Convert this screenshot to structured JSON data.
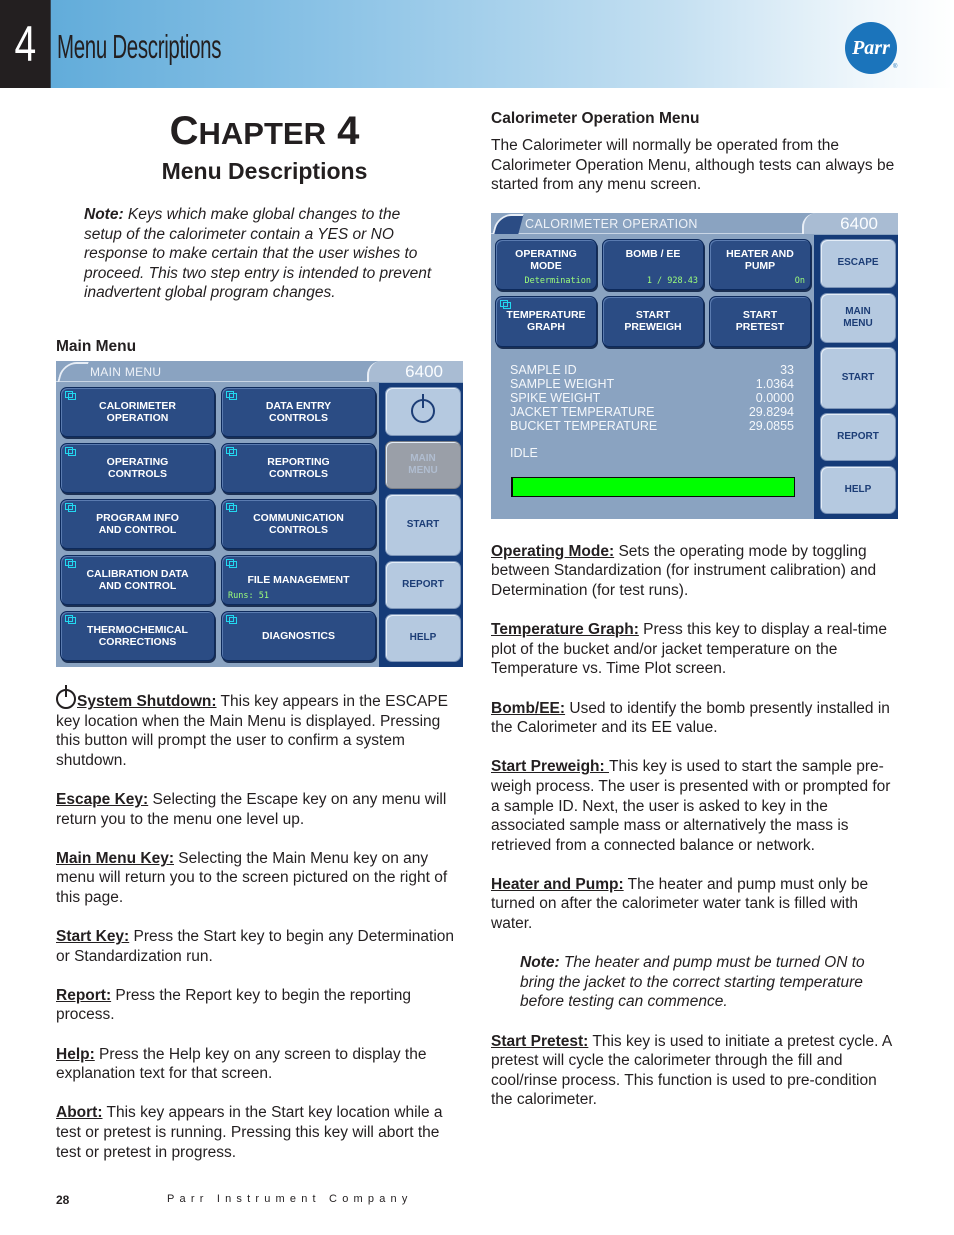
{
  "header": {
    "chapter_number": "4",
    "title": "Menu Descriptions",
    "logo_text": "Parr",
    "logo_reg": "®"
  },
  "left": {
    "chapter_word_first": "C",
    "chapter_word_rest": "HAPTER",
    "chapter_number": "4",
    "subtitle": "Menu Descriptions",
    "note_label": "Note:",
    "note_text": " Keys which make global changes to the setup of the calorimeter contain a YES or NO response to make certain that the user wishes to proceed.  This two step entry is intended to prevent inadvertent global program changes.",
    "main_menu_heading": "Main Menu",
    "main_menu_screen": {
      "title": "MAIN MENU",
      "model": "6400",
      "buttons": [
        {
          "label1": "CALORIMETER",
          "label2": "OPERATION"
        },
        {
          "label1": "DATA ENTRY",
          "label2": "CONTROLS"
        },
        {
          "label1": "OPERATING",
          "label2": "CONTROLS"
        },
        {
          "label1": "REPORTING",
          "label2": "CONTROLS"
        },
        {
          "label1": "PROGRAM INFO",
          "label2": "AND CONTROL"
        },
        {
          "label1": "COMMUNICATION",
          "label2": "CONTROLS"
        },
        {
          "label1": "CALIBRATION DATA",
          "label2": "AND CONTROL"
        },
        {
          "label1": "FILE MANAGEMENT",
          "label2": "",
          "value": "Runs: 51"
        },
        {
          "label1": "THERMOCHEMICAL",
          "label2": "CORRECTIONS"
        },
        {
          "label1": "DIAGNOSTICS",
          "label2": ""
        }
      ],
      "side": {
        "power_icon": "power-icon",
        "main_menu1": "MAIN",
        "main_menu2": "MENU",
        "start": "START",
        "report": "REPORT",
        "help": "HELP"
      }
    },
    "paragraphs": [
      {
        "term": "System Shutdown:",
        "text": "  This key appears in the ESCAPE key location when the Main Menu is displayed. Pressing this button will prompt the user to confirm a system shutdown.",
        "icon": "power-icon"
      },
      {
        "term": "Escape Key:",
        "text": "  Selecting the Escape key on any menu will return you to the menu one level up."
      },
      {
        "term": "Main Menu Key:",
        "text": "  Selecting the Main Menu key on any menu will return you to the screen pictured on the right of this page."
      },
      {
        "term": "Start Key:",
        "text": "  Press the Start key to begin any Determination or Standardization run."
      },
      {
        "term": "Report:",
        "text": "  Press the Report key to begin the reporting process."
      },
      {
        "term": "Help:",
        "text": "  Press the Help key on any screen to display the explanation text for that screen."
      },
      {
        "term": "Abort:",
        "text": "  This key appears in the Start key location while a test or pretest is running. Pressing this key will abort the test or pretest in progress."
      }
    ]
  },
  "right": {
    "heading": "Calorimeter Operation Menu",
    "intro": "The Calorimeter will normally be operated from the Calorimeter Operation Menu, although tests can always be started from any menu screen.",
    "operation_screen": {
      "title": "CALORIMETER OPERATION",
      "model": "6400",
      "buttons": [
        {
          "label1": "OPERATING",
          "label2": "MODE",
          "value": "Determination"
        },
        {
          "label1": "BOMB / EE",
          "label2": "",
          "value": "1 / 928.43"
        },
        {
          "label1": "HEATER AND",
          "label2": "PUMP",
          "value": "On"
        },
        {
          "label1": "TEMPERATURE",
          "label2": "GRAPH"
        },
        {
          "label1": "START",
          "label2": "PREWEIGH"
        },
        {
          "label1": "START",
          "label2": "PRETEST"
        }
      ],
      "readouts": [
        {
          "label": "SAMPLE ID",
          "value": "33"
        },
        {
          "label": "SAMPLE WEIGHT",
          "value": "1.0364"
        },
        {
          "label": "SPIKE WEIGHT",
          "value": "0.0000"
        },
        {
          "label": "JACKET TEMPERATURE",
          "value": "29.8294"
        },
        {
          "label": "BUCKET TEMPERATURE",
          "value": "29.0855"
        }
      ],
      "status": "IDLE",
      "progress_percent": 100,
      "progress_color": "#00ff00",
      "side": {
        "escape": "ESCAPE",
        "main_menu1": "MAIN",
        "main_menu2": "MENU",
        "start": "START",
        "report": "REPORT",
        "help": "HELP"
      }
    },
    "paragraphs": [
      {
        "term": "Operating Mode:",
        "text": "  Sets the operating mode by toggling between Standardization (for instrument calibration) and Determination (for test runs)."
      },
      {
        "term": "Temperature Graph:",
        "text": "  Press this key to display a real-time plot of the bucket and/or jacket temperature on the Temperature vs. Time Plot screen."
      },
      {
        "term": "Bomb/EE:",
        "text": "  Used to identify the bomb presently installed in the Calorimeter and its EE value."
      },
      {
        "term": "Start Preweigh: ",
        "text": "This key is used to start the sample pre-weigh process.  The user is presented with or prompted for a sample ID.  Next, the user is asked to key in the associated sample mass or alternatively the mass is retrieved from a connected balance or network."
      },
      {
        "term": "Heater and Pump:",
        "text": " The heater and pump must only be turned on after the calorimeter water tank is filled with water."
      }
    ],
    "note_label": "Note:",
    "note_text": " The heater and pump must be turned ON to bring the jacket to the correct starting temperature before testing can commence.",
    "final_paragraph": {
      "term": "Start Pretest:",
      "text": " This key is used to initiate a pretest cycle.  A pretest will cycle the calorimeter through the fill and cool/rinse process.  This function is used to pre-condition the calorimeter."
    }
  },
  "footer": {
    "page_number": "28",
    "company": "Parr Instrument Company"
  },
  "colors": {
    "header_gradient_start": "#5aa8d8",
    "logo_blue": "#1b74bb",
    "screen_bg": "#8aa3c1",
    "dark_button": "#2b4c84",
    "side_panel": "#153b78",
    "light_button": "#b5c9e0",
    "value_green": "#9dff7a"
  }
}
